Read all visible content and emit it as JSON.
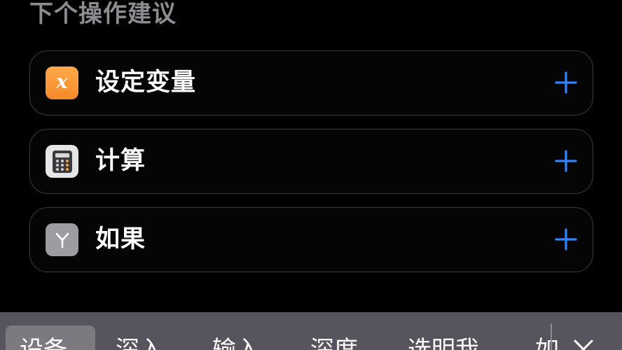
{
  "section": {
    "title": "下个操作建议"
  },
  "actions": [
    {
      "label": "设定变量",
      "icon": "variable-x-icon",
      "icon_glyph": "x",
      "icon_color": "#f8962f"
    },
    {
      "label": "计算",
      "icon": "calculator-icon",
      "icon_color": "#e6e6e6"
    },
    {
      "label": "如果",
      "icon": "if-branch-icon",
      "icon_color": "#9c9ca1"
    }
  ],
  "add_button_color": "#2f86ff",
  "keyboard": {
    "candidates": [
      "设备",
      "深入",
      "输入",
      "深度",
      "选明我",
      "如"
    ],
    "selected_index": 0,
    "collapse_icon": "close-x-icon",
    "bar_color": "#56545c"
  }
}
